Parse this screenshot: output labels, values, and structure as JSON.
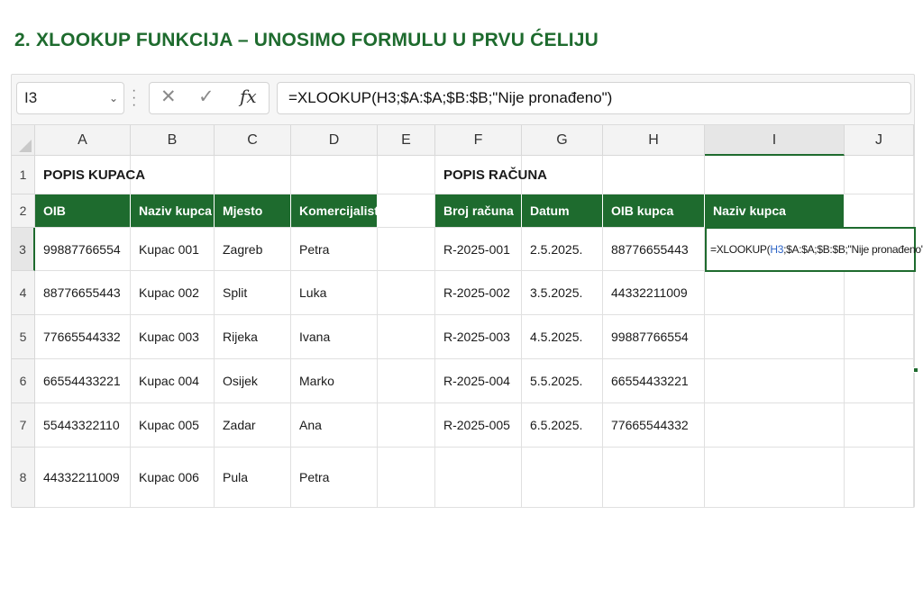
{
  "title": "2. XLOOKUP FUNKCIJA – UNOSIMO FORMULU U PRVU ĆELIJU",
  "formula_bar": {
    "name_box": "I3",
    "formula": "=XLOOKUP(H3;$A:$A;$B:$B;\"Nije pronađeno\")",
    "icons": [
      "cancel-icon",
      "enter-icon",
      "function-icon"
    ]
  },
  "columns": [
    "A",
    "B",
    "C",
    "D",
    "E",
    "F",
    "G",
    "H",
    "I",
    "J"
  ],
  "rows": [
    "1",
    "2",
    "3",
    "4",
    "5",
    "6",
    "7",
    "8"
  ],
  "active_cell": "I3",
  "customers": {
    "section_title": "POPIS KUPACA",
    "headers": [
      "OIB",
      "Naziv kupca",
      "Mjesto",
      "Komercijalist"
    ],
    "rows": [
      [
        "99887766554",
        "Kupac 001",
        "Zagreb",
        "Petra"
      ],
      [
        "88776655443",
        "Kupac 002",
        "Split",
        "Luka"
      ],
      [
        "77665544332",
        "Kupac 003",
        "Rijeka",
        "Ivana"
      ],
      [
        "66554433221",
        "Kupac 004",
        "Osijek",
        "Marko"
      ],
      [
        "55443322110",
        "Kupac 005",
        "Zadar",
        "Ana"
      ],
      [
        "44332211009",
        "Kupac 006",
        "Pula",
        "Petra"
      ]
    ]
  },
  "invoices": {
    "section_title": "POPIS RAČUNA",
    "headers": [
      "Broj računa",
      "Datum",
      "OIB kupca",
      "Naziv kupca"
    ],
    "rows": [
      [
        "R-2025-001",
        "2.5.2025.",
        "88776655443",
        ""
      ],
      [
        "R-2025-002",
        "3.5.2025.",
        "44332211009",
        ""
      ],
      [
        "R-2025-003",
        "4.5.2025.",
        "99887766554",
        ""
      ],
      [
        "R-2025-004",
        "5.5.2025.",
        "66554433221",
        ""
      ],
      [
        "R-2025-005",
        "6.5.2025.",
        "77665544332",
        ""
      ]
    ]
  },
  "cell_I3": {
    "prefix": "=XLOOKUP(",
    "ref": "H3",
    "suffix": ";$A:$A;$B:$B;\"Nije pronađeno\")"
  },
  "colors": {
    "accent": "#1e6b2e",
    "ref_blue": "#2b63c6"
  }
}
